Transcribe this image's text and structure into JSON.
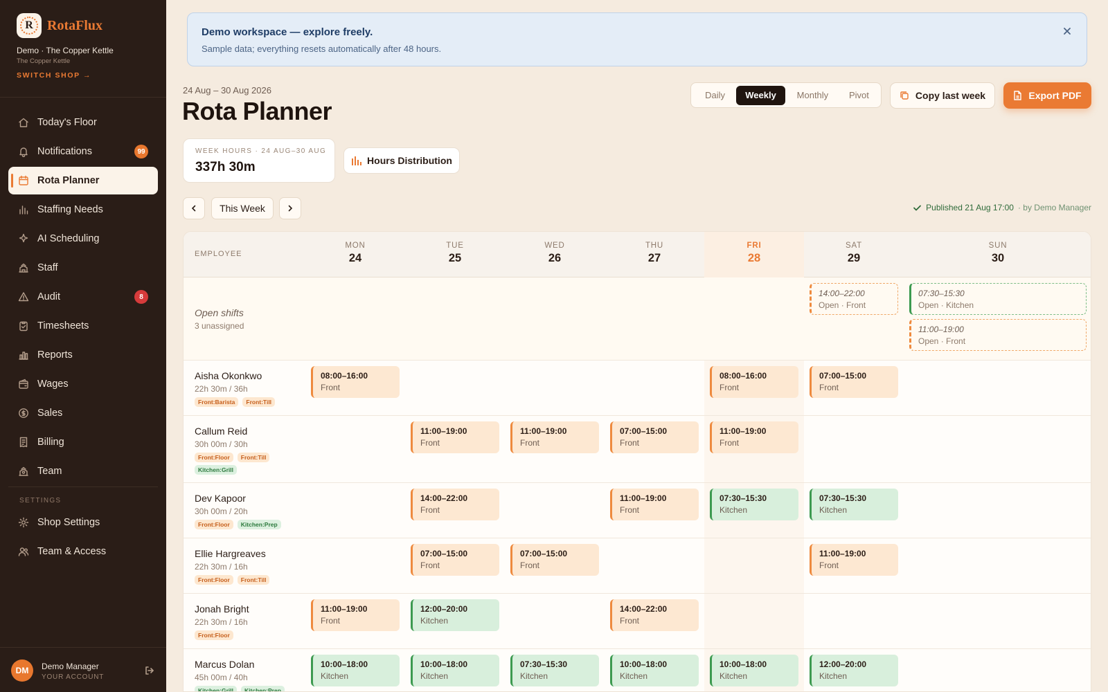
{
  "brand": {
    "name": "RotaFlux",
    "logo_letter": "R"
  },
  "shop": {
    "name": "Demo · The Copper Kettle",
    "sub": "The Copper Kettle",
    "switch_label": "SWITCH SHOP →"
  },
  "nav": {
    "items": [
      {
        "label": "Today's Floor",
        "icon": "home-icon"
      },
      {
        "label": "Notifications",
        "icon": "bell-icon",
        "badge": "99",
        "badge_color": "#e8772e"
      },
      {
        "label": "Rota Planner",
        "icon": "calendar-icon",
        "active": true
      },
      {
        "label": "Staffing Needs",
        "icon": "bar-chart-icon"
      },
      {
        "label": "AI Scheduling",
        "icon": "sparkle-icon"
      },
      {
        "label": "Staff",
        "icon": "staff-icon"
      },
      {
        "label": "Audit",
        "icon": "warning-icon",
        "badge": "8",
        "badge_color": "#d63b3b"
      },
      {
        "label": "Timesheets",
        "icon": "clipboard-icon"
      },
      {
        "label": "Reports",
        "icon": "reports-icon"
      },
      {
        "label": "Wages",
        "icon": "wallet-icon"
      },
      {
        "label": "Sales",
        "icon": "dollar-icon"
      },
      {
        "label": "Billing",
        "icon": "receipt-icon"
      },
      {
        "label": "Team",
        "icon": "team-icon"
      }
    ],
    "settings_label": "SETTINGS",
    "settings_items": [
      {
        "label": "Shop Settings",
        "icon": "gear-icon"
      },
      {
        "label": "Team & Access",
        "icon": "users-icon"
      }
    ]
  },
  "account": {
    "initials": "DM",
    "name": "Demo Manager",
    "sub": "YOUR ACCOUNT"
  },
  "banner": {
    "title": "Demo workspace — explore freely.",
    "text": "Sample data; everything resets automatically after 48 hours."
  },
  "header": {
    "date_range": "24 Aug – 30 Aug 2026",
    "title": "Rota Planner",
    "views": [
      "Daily",
      "Weekly",
      "Monthly",
      "Pivot"
    ],
    "active_view": "Weekly",
    "copy_label": "Copy last week",
    "export_label": "Export PDF"
  },
  "summary": {
    "label": "WEEK HOURS · 24 AUG–30 AUG",
    "value": "337h 30m",
    "dist_label": "Hours Distribution"
  },
  "week_nav": {
    "this_week": "This Week"
  },
  "published": {
    "text": "Published 21 Aug 17:00",
    "by": "· by Demo Manager"
  },
  "grid": {
    "employee_label": "EMPLOYEE",
    "days": [
      {
        "name": "MON",
        "num": "24"
      },
      {
        "name": "TUE",
        "num": "25"
      },
      {
        "name": "WED",
        "num": "26"
      },
      {
        "name": "THU",
        "num": "27"
      },
      {
        "name": "FRI",
        "num": "28",
        "today": true
      },
      {
        "name": "SAT",
        "num": "29"
      },
      {
        "name": "SUN",
        "num": "30"
      }
    ],
    "open_shifts": {
      "label": "Open shifts",
      "sub": "3 unassigned",
      "shifts": [
        {
          "day": 5,
          "slot": 0,
          "time": "14:00–22:00",
          "area": "Open · Front",
          "type": "open-front"
        },
        {
          "day": 6,
          "slot": 0,
          "time": "07:30–15:30",
          "area": "Open · Kitchen",
          "type": "open-kitchen"
        },
        {
          "day": 6,
          "slot": 1,
          "time": "11:00–19:00",
          "area": "Open · Front",
          "type": "open-front"
        }
      ]
    },
    "employees": [
      {
        "name": "Aisha Okonkwo",
        "hours": "22h 30m / 36h",
        "tags": [
          {
            "label": "Front:Barista",
            "type": "front"
          },
          {
            "label": "Front:Till",
            "type": "front"
          }
        ],
        "shifts": [
          {
            "day": 0,
            "time": "08:00–16:00",
            "area": "Front",
            "type": "front"
          },
          {
            "day": 4,
            "time": "08:00–16:00",
            "area": "Front",
            "type": "front"
          },
          {
            "day": 5,
            "time": "07:00–15:00",
            "area": "Front",
            "type": "front"
          }
        ]
      },
      {
        "name": "Callum Reid",
        "hours": "30h 00m / 30h",
        "tags": [
          {
            "label": "Front:Floor",
            "type": "front"
          },
          {
            "label": "Front:Till",
            "type": "front"
          },
          {
            "label": "Kitchen:Grill",
            "type": "kitchen"
          }
        ],
        "shifts": [
          {
            "day": 1,
            "time": "11:00–19:00",
            "area": "Front",
            "type": "front"
          },
          {
            "day": 2,
            "time": "11:00–19:00",
            "area": "Front",
            "type": "front"
          },
          {
            "day": 3,
            "time": "07:00–15:00",
            "area": "Front",
            "type": "front"
          },
          {
            "day": 4,
            "time": "11:00–19:00",
            "area": "Front",
            "type": "front"
          }
        ]
      },
      {
        "name": "Dev Kapoor",
        "hours": "30h 00m / 20h",
        "tags": [
          {
            "label": "Front:Floor",
            "type": "front"
          },
          {
            "label": "Kitchen:Prep",
            "type": "kitchen"
          }
        ],
        "shifts": [
          {
            "day": 1,
            "time": "14:00–22:00",
            "area": "Front",
            "type": "front"
          },
          {
            "day": 3,
            "time": "11:00–19:00",
            "area": "Front",
            "type": "front"
          },
          {
            "day": 4,
            "time": "07:30–15:30",
            "area": "Kitchen",
            "type": "kitchen"
          },
          {
            "day": 5,
            "time": "07:30–15:30",
            "area": "Kitchen",
            "type": "kitchen"
          }
        ]
      },
      {
        "name": "Ellie Hargreaves",
        "hours": "22h 30m / 16h",
        "tags": [
          {
            "label": "Front:Floor",
            "type": "front"
          },
          {
            "label": "Front:Till",
            "type": "front"
          }
        ],
        "shifts": [
          {
            "day": 1,
            "time": "07:00–15:00",
            "area": "Front",
            "type": "front"
          },
          {
            "day": 2,
            "time": "07:00–15:00",
            "area": "Front",
            "type": "front"
          },
          {
            "day": 5,
            "time": "11:00–19:00",
            "area": "Front",
            "type": "front"
          }
        ]
      },
      {
        "name": "Jonah Bright",
        "hours": "22h 30m / 16h",
        "tags": [
          {
            "label": "Front:Floor",
            "type": "front"
          }
        ],
        "shifts": [
          {
            "day": 0,
            "time": "11:00–19:00",
            "area": "Front",
            "type": "front"
          },
          {
            "day": 1,
            "time": "12:00–20:00",
            "area": "Kitchen",
            "type": "kitchen"
          },
          {
            "day": 3,
            "time": "14:00–22:00",
            "area": "Front",
            "type": "front"
          }
        ]
      },
      {
        "name": "Marcus Dolan",
        "hours": "45h 00m / 40h",
        "tags": [
          {
            "label": "Kitchen:Grill",
            "type": "kitchen"
          },
          {
            "label": "Kitchen:Prep",
            "type": "kitchen"
          }
        ],
        "shifts": [
          {
            "day": 0,
            "time": "10:00–18:00",
            "area": "Kitchen",
            "type": "kitchen"
          },
          {
            "day": 1,
            "time": "10:00–18:00",
            "area": "Kitchen",
            "type": "kitchen"
          },
          {
            "day": 2,
            "time": "07:30–15:30",
            "area": "Kitchen",
            "type": "kitchen"
          },
          {
            "day": 3,
            "time": "10:00–18:00",
            "area": "Kitchen",
            "type": "kitchen"
          },
          {
            "day": 4,
            "time": "10:00–18:00",
            "area": "Kitchen",
            "type": "kitchen"
          },
          {
            "day": 5,
            "time": "12:00–20:00",
            "area": "Kitchen",
            "type": "kitchen"
          }
        ]
      }
    ]
  }
}
